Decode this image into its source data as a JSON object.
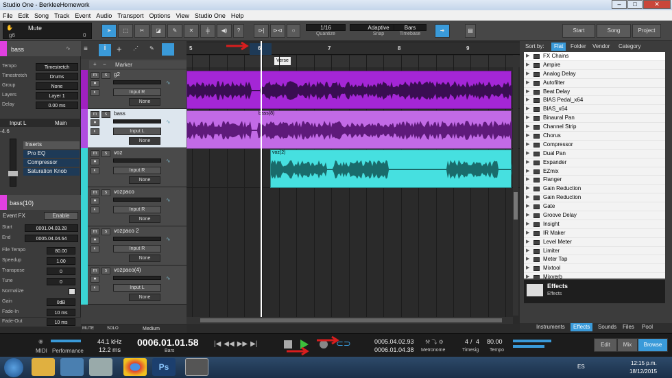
{
  "window": {
    "title": "Studio One - BerkleeHomework",
    "minimize": "–",
    "maximize": "□",
    "close": "✕"
  },
  "menu": [
    "File",
    "Edit",
    "Song",
    "Track",
    "Event",
    "Audio",
    "Transport",
    "Options",
    "View",
    "Studio One",
    "Help"
  ],
  "toolbar": {
    "mute_label": "Mute",
    "mute_sub": "g6",
    "mute_value": "0",
    "quantize_value": "1/16",
    "quantize_label": "Quantize",
    "snap_value": "Adaptive",
    "snap_label": "Snap",
    "timebase_value": "Bars",
    "timebase_label": "Timebase",
    "start_label": "Start",
    "song_label": "Song",
    "project_label": "Project",
    "help_glyph": "?"
  },
  "inspector": {
    "track_name": "bass",
    "rows": [
      {
        "label": "Tempo",
        "value": "Timestretch"
      },
      {
        "label": "Timestretch",
        "value": "Drums"
      },
      {
        "label": "Group",
        "value": "None"
      },
      {
        "label": "Layers",
        "value": "Layer 1"
      },
      {
        "label": "Delay",
        "value": "0.00 ms"
      }
    ],
    "input_label": "Input L",
    "output_label": "Main",
    "volume": "-4.6",
    "inserts_label": "Inserts",
    "inserts": [
      "Pro EQ",
      "Compressor",
      "Saturation Knob"
    ],
    "event_name": "bass(10)",
    "event_fx_label": "Event FX",
    "enable_label": "Enable",
    "event_rows": [
      {
        "label": "Start",
        "value": "0001.04.03.28"
      },
      {
        "label": "End",
        "value": "0005.04.04.64"
      }
    ],
    "event_rows2": [
      {
        "label": "File Tempo",
        "value": "80.00"
      },
      {
        "label": "Speedup",
        "value": "1.00"
      },
      {
        "label": "Transpose",
        "value": "0"
      },
      {
        "label": "Tune",
        "value": "0"
      },
      {
        "label": "Normalize",
        "value": ""
      },
      {
        "label": "Gain",
        "value": "0dB"
      },
      {
        "label": "Fade-In",
        "value": "10 ms"
      },
      {
        "label": "Fade-Out",
        "value": "10 ms"
      }
    ]
  },
  "tracklist": {
    "marker_label": "Marker",
    "tracks": [
      {
        "name": "g2",
        "input": "Input R",
        "none": "None",
        "m": "m",
        "s": "s",
        "color": "#a020c0"
      },
      {
        "name": "bass",
        "input": "Input L",
        "none": "None",
        "m": "m",
        "s": "s",
        "color": "#b04de0"
      },
      {
        "name": "voz",
        "input": "Input R",
        "none": "None",
        "m": "m",
        "s": "s",
        "color": "#3ad4d4"
      },
      {
        "name": "vozpaco",
        "input": "Input R",
        "none": "None",
        "m": "m",
        "s": "s",
        "color": "#3ad4d4"
      },
      {
        "name": "vozpaco 2",
        "input": "Input R",
        "none": "None",
        "m": "m",
        "s": "s",
        "color": "#3ad4d4"
      },
      {
        "name": "vozpaco(4)",
        "input": "Input L",
        "none": "None",
        "m": "m",
        "s": "s",
        "color": "#3ad4d4"
      }
    ],
    "mute_label": "MUTE",
    "solo_label": "SOLO",
    "zoom_label": "Medium"
  },
  "arrange": {
    "bars": [
      "5",
      "6",
      "7",
      "8",
      "9"
    ],
    "marker": "Verse",
    "clips": [
      {
        "name": "",
        "color": "#a426d6"
      },
      {
        "name": "bass(8)",
        "color": "#c26ae6"
      },
      {
        "name": "voz(2)",
        "color": "#46e0e0"
      }
    ]
  },
  "browser": {
    "sort_label": "Sort by:",
    "sort_tabs": [
      "Flat",
      "Folder",
      "Vendor",
      "Category"
    ],
    "items": [
      "FX Chains",
      "Ampire",
      "Analog Delay",
      "Autofilter",
      "Beat Delay",
      "BIAS Pedal_x64",
      "BIAS_x64",
      "Binaural Pan",
      "Channel Strip",
      "Chorus",
      "Compressor",
      "Dual Pan",
      "Expander",
      "EZmix",
      "Flanger",
      "Gain Reduction",
      "Gain Reduction",
      "Gate",
      "Groove Delay",
      "Insight",
      "IR Maker",
      "Level Meter",
      "Limiter",
      "Meter Tap",
      "Mixtool",
      "Mixverb"
    ],
    "folder_title": "Effects",
    "folder_sub": "Effects",
    "bottom_tabs": [
      "Instruments",
      "Effects",
      "Sounds",
      "Files",
      "Pool"
    ]
  },
  "transport": {
    "midi_label": "MIDI",
    "performance_label": "Performance",
    "sample_rate": "44.1 kHz",
    "latency": "12.2 ms",
    "position": "0006.01.01.58",
    "position_unit": "Bars",
    "loop_start": "0005.04.02.93",
    "loop_end": "0006.01.04.38",
    "metronome_label": "Metronome",
    "timesig_num": "4",
    "timesig_den": "4",
    "timesig_label": "Timesig",
    "tempo_value": "80.00",
    "tempo_label": "Tempo",
    "edit_label": "Edit",
    "mix_label": "Mix",
    "browse_label": "Browse"
  },
  "taskbar": {
    "language": "ES",
    "time": "12:15 p.m.",
    "date": "18/12/2015",
    "ps_label": "Ps"
  },
  "colors": {
    "accent": "#3a9ad9",
    "annotation_red": "#d81e1e"
  }
}
